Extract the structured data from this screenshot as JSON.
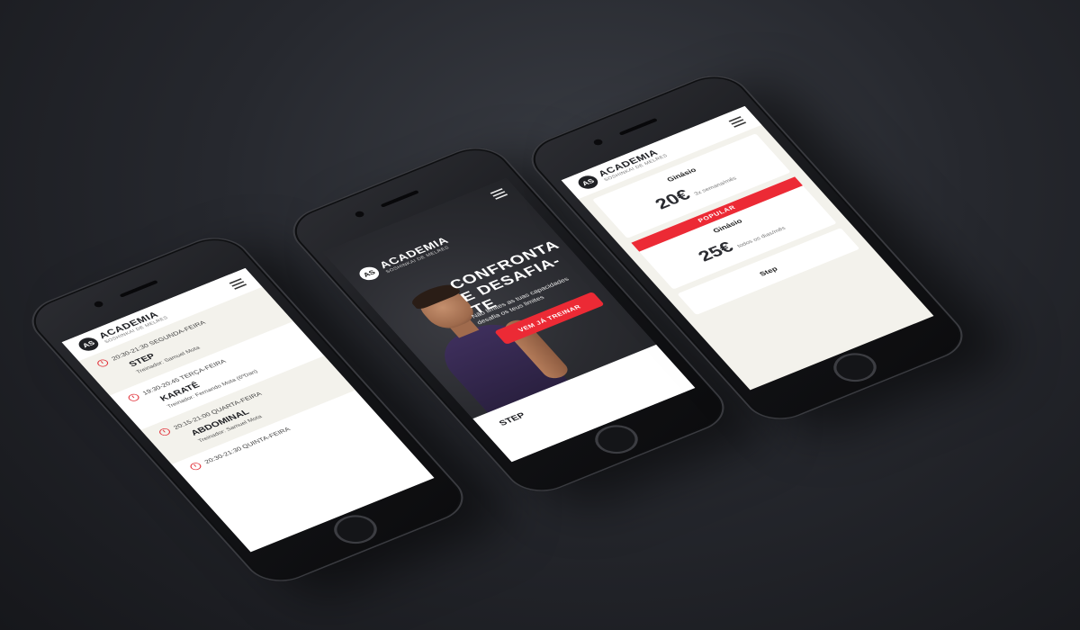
{
  "brand": {
    "name": "ACADEMIA",
    "sub": "SOSHINKAI DE MELRES",
    "logo": "AS"
  },
  "schedule": {
    "items": [
      {
        "time": "20:30-21:30 SEGUNDA-FEIRA",
        "class": "STEP",
        "trainer": "Treinador: Samuel Mota"
      },
      {
        "time": "19:30-20:45 TERÇA-FEIRA",
        "class": "KARATÊ",
        "trainer": "Treinador: Fernando Mota (6ºDan)"
      },
      {
        "time": "20:15-21:00 QUARTA-FEIRA",
        "class": "ABDOMINAL",
        "trainer": "Treinador: Samuel Mota"
      },
      {
        "time": "20:30-21:30 QUINTA-FEIRA",
        "class": "",
        "trainer": ""
      }
    ]
  },
  "hero": {
    "title": "CONFRONTA E DESAFIA-TE",
    "subtitle": "Não limites as tuas capacidades desafia os teus limites",
    "cta": "VEM JÁ TREINAR",
    "peek": "STEP"
  },
  "pricing": {
    "plans": [
      {
        "name": "Ginásio",
        "price": "20€",
        "freq": "3x semana/mês",
        "badge": ""
      },
      {
        "name": "Ginásio",
        "price": "25€",
        "freq": "todos os dias/mês",
        "badge": "POPULAR"
      },
      {
        "name": "Step",
        "price": "",
        "freq": "",
        "badge": ""
      }
    ]
  },
  "colors": {
    "accent": "#ec2a35",
    "dark": "#2b2c31",
    "light_bg": "#f3f2ec"
  }
}
